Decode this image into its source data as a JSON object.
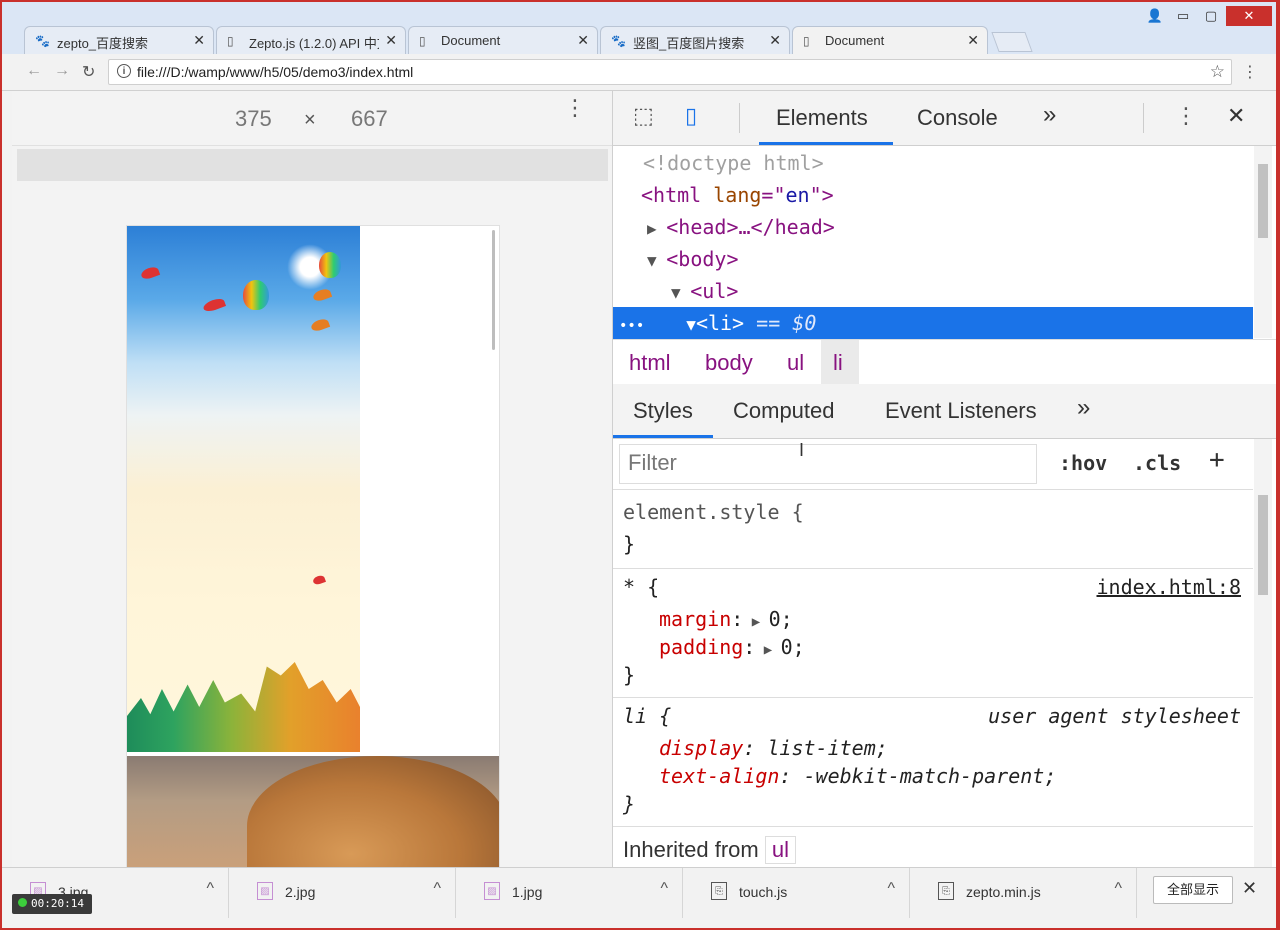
{
  "browser": {
    "tabs": [
      {
        "label": "zepto_百度搜索",
        "icon": "baidu-paw-icon"
      },
      {
        "label": "Zepto.js (1.2.0) API 中文",
        "icon": "document-icon"
      },
      {
        "label": "Document",
        "icon": "document-icon"
      },
      {
        "label": "竖图_百度图片搜索",
        "icon": "baidu-paw-icon"
      },
      {
        "label": "Document",
        "icon": "document-icon"
      }
    ],
    "active_tab": 4,
    "url": "file:///D:/wamp/www/h5/05/demo3/index.html"
  },
  "device": {
    "width": "375",
    "times": "×",
    "height": "667"
  },
  "devtools": {
    "panels": [
      "Elements",
      "Console"
    ],
    "more": "»",
    "close": "✕",
    "dom": {
      "line1": "<!doctype html>",
      "line2_tag_open": "<html ",
      "line2_attr": "lang",
      "line2_eq": "=\"",
      "line2_val": "en",
      "line2_end": "\">",
      "line3": "<head>…</head>",
      "line4": "<body>",
      "line5": "<ul>",
      "line6_tag": "<li>",
      "line6_eq": " == $0",
      "dots": "•••"
    },
    "breadcrumbs": [
      "html",
      "body",
      "ul",
      "li"
    ],
    "subtabs": [
      "Styles",
      "Computed",
      "Event Listeners",
      "»"
    ],
    "filter_placeholder": "Filter",
    "hov": ":hov",
    "cls": ".cls",
    "plus": "+",
    "rules": {
      "element_style": "element.style {",
      "close_brace": "}",
      "star_selector": "* {",
      "star_source": "index.html:8",
      "margin_name": "margin",
      "margin_value": "0;",
      "padding_name": "padding",
      "padding_value": "0;",
      "li_selector": "li {",
      "li_source": "user agent stylesheet",
      "display_name": "display",
      "display_value": "list-item;",
      "textalign_name": "text-align",
      "textalign_value": "-webkit-match-parent;"
    },
    "inherited_label": "Inherited from",
    "inherited_tag": "ul"
  },
  "downloads": {
    "items": [
      "3.jpg",
      "2.jpg",
      "1.jpg",
      "touch.js",
      "zepto.min.js"
    ],
    "show_all": "全部显示"
  },
  "recorder": {
    "time": "00:20:14"
  }
}
